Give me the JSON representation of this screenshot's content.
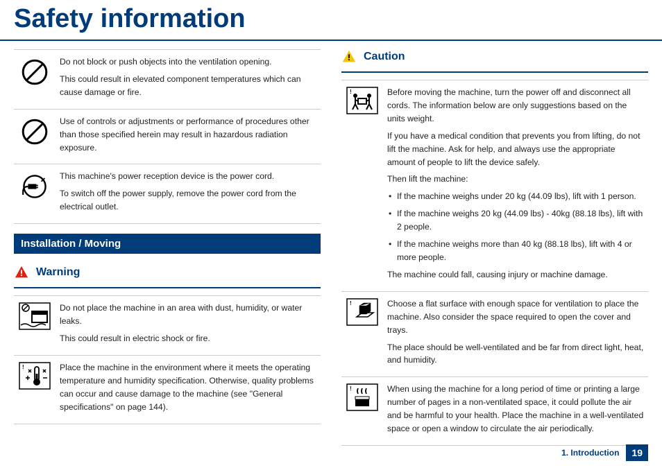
{
  "title": "Safety information",
  "left": {
    "top_table": [
      {
        "text": [
          "Do not block or push objects into the ventilation opening.",
          "This could result in elevated component temperatures which can cause damage or fire."
        ]
      },
      {
        "text": [
          "Use of controls or adjustments or performance of procedures other than those specified herein may result in hazardous radiation exposure."
        ]
      },
      {
        "text": [
          "This machine's power reception device is the power cord.",
          "To switch off the power supply, remove the power cord from the electrical outlet."
        ]
      }
    ],
    "section_bar": "Installation / Moving",
    "warning_heading": "Warning",
    "warning_table": [
      {
        "text": [
          "Do not place the machine in an area with dust, humidity, or water leaks.",
          "This could result in electric shock or fire."
        ]
      },
      {
        "text": [
          "Place the machine in the environment where it meets the operating temperature and humidity specification. Otherwise, quality problems can occur and cause damage to the machine (see \"General specifications\" on page 144)."
        ]
      }
    ]
  },
  "right": {
    "caution_heading": "Caution",
    "caution_table": [
      {
        "para_before": [
          "Before moving the machine, turn the power off and disconnect all cords. The information below are only suggestions based on the units weight.",
          "If you have a medical condition that prevents you from lifting, do not lift the machine. Ask for help, and always use the appropriate amount of people to lift the device safely.",
          "Then lift the machine:"
        ],
        "bullets": [
          "If the machine weighs under 20 kg (44.09 lbs), lift with 1 person.",
          "If the machine weighs 20 kg (44.09 lbs) - 40kg (88.18 lbs), lift with 2 people.",
          "If the machine weighs more than 40 kg (88.18 lbs), lift with 4 or more people."
        ],
        "para_after": [
          "The machine could fall, causing injury or machine damage."
        ]
      },
      {
        "para_before": [
          "Choose a flat surface with enough space for ventilation to place the machine. Also consider the space required to open the cover and trays.",
          "The place should be well-ventilated and be far from direct light, heat, and humidity."
        ]
      },
      {
        "para_before": [
          "When using the machine for a long period of time or printing a large number of pages in a non-ventilated space, it could pollute the air and be harmful to your health. Place the machine in a well-ventilated space or open a window to circulate the air periodically."
        ]
      }
    ]
  },
  "footer": {
    "label": "1. Introduction",
    "page": "19"
  }
}
